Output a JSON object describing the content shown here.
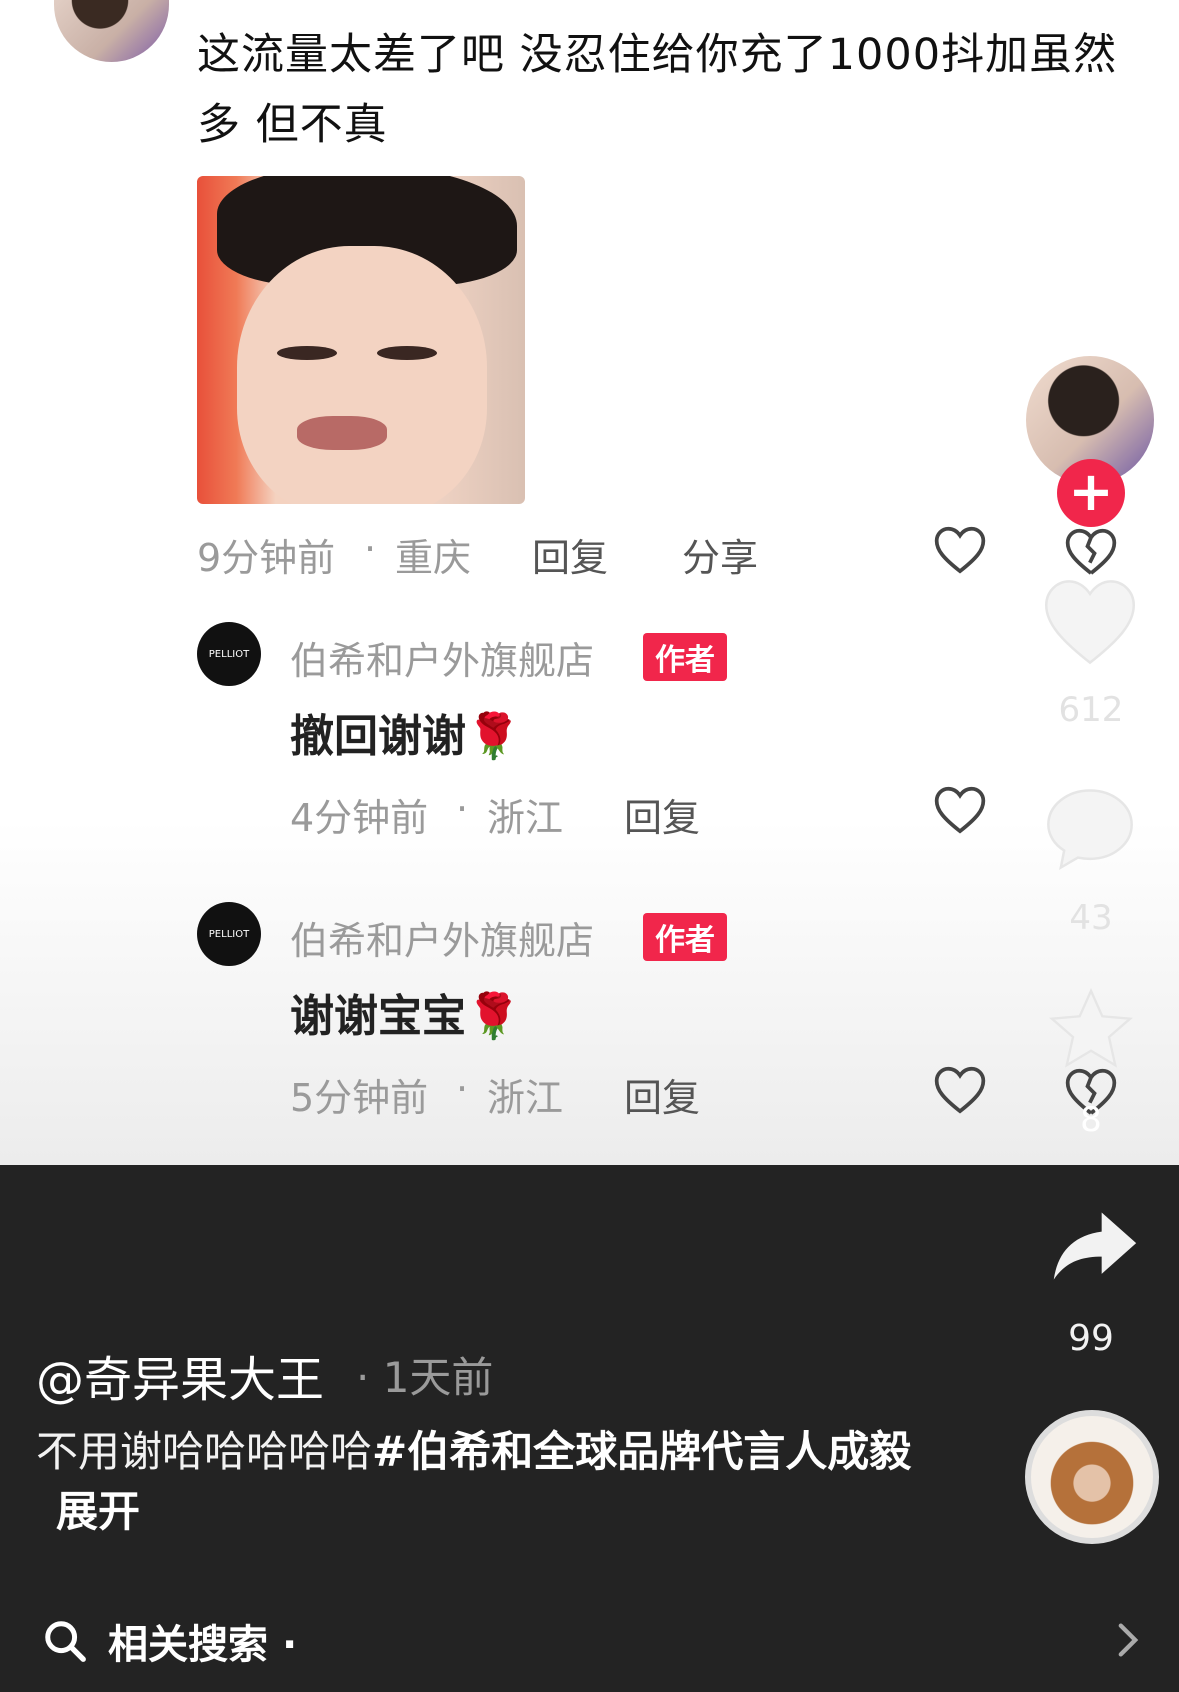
{
  "comment": {
    "text": "这流量太差了吧 没忍住给你充了1000抖加虽然多 但不真",
    "time": "9分钟前",
    "location": "重庆",
    "reply_label": "回复",
    "share_label": "分享"
  },
  "replies": [
    {
      "name": "伯希和户外旗舰店",
      "badge": "作者",
      "text": "撤回谢谢🌹",
      "time": "4分钟前",
      "location": "浙江",
      "reply_label": "回复",
      "avatar_text": "PELLIOT"
    },
    {
      "name": "伯希和户外旗舰店",
      "badge": "作者",
      "text": "谢谢宝宝🌹",
      "time": "5分钟前",
      "location": "浙江",
      "reply_label": "回复",
      "avatar_text": "PELLIOT"
    }
  ],
  "rail": {
    "follow": "+",
    "like_count": "612",
    "comment_count": "43",
    "favorite_count": "8",
    "share_count": "99"
  },
  "post": {
    "username": "@奇异果大王",
    "time": "1天前",
    "caption": "不用谢哈哈哈哈哈",
    "hashtag": "#伯希和全球品牌代言人成毅",
    "expand": "展开"
  },
  "search": {
    "label": "相关搜索",
    "separator": "·"
  },
  "colors": {
    "accent": "#f1264b",
    "dark_bg": "#232323"
  },
  "icons": {
    "like": "heart-outline-icon",
    "dislike": "broken-heart-icon",
    "share": "share-arrow-icon",
    "search": "search-icon",
    "chevron": "chevron-right-icon"
  }
}
